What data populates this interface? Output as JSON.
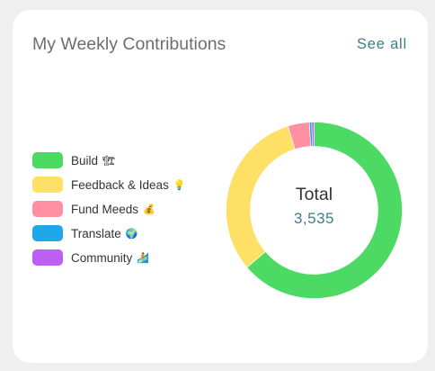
{
  "card": {
    "title": "My Weekly Contributions",
    "see_all_label": "See all"
  },
  "legend": {
    "items": [
      {
        "label": "Build",
        "emoji": "🏗",
        "color": "#4cd964"
      },
      {
        "label": "Feedback & Ideas",
        "emoji": "💡",
        "color": "#ffe066"
      },
      {
        "label": "Fund Meeds",
        "emoji": "💰",
        "color": "#ff8fa3"
      },
      {
        "label": "Translate",
        "emoji": "🌍",
        "color": "#1ea7e9"
      },
      {
        "label": "Community",
        "emoji": "🏄",
        "color": "#bd5ff2"
      }
    ]
  },
  "center": {
    "label": "Total",
    "value": "3,535"
  },
  "chart_data": {
    "type": "pie",
    "hole": true,
    "categories": [
      "Build",
      "Feedback & Ideas",
      "Fund Meeds",
      "Translate",
      "Community"
    ],
    "values": [
      2255,
      1110,
      140,
      15,
      15
    ],
    "colors": [
      "#4cd964",
      "#ffe066",
      "#ff8fa3",
      "#1ea7e9",
      "#bd5ff2"
    ],
    "total": 3535
  }
}
